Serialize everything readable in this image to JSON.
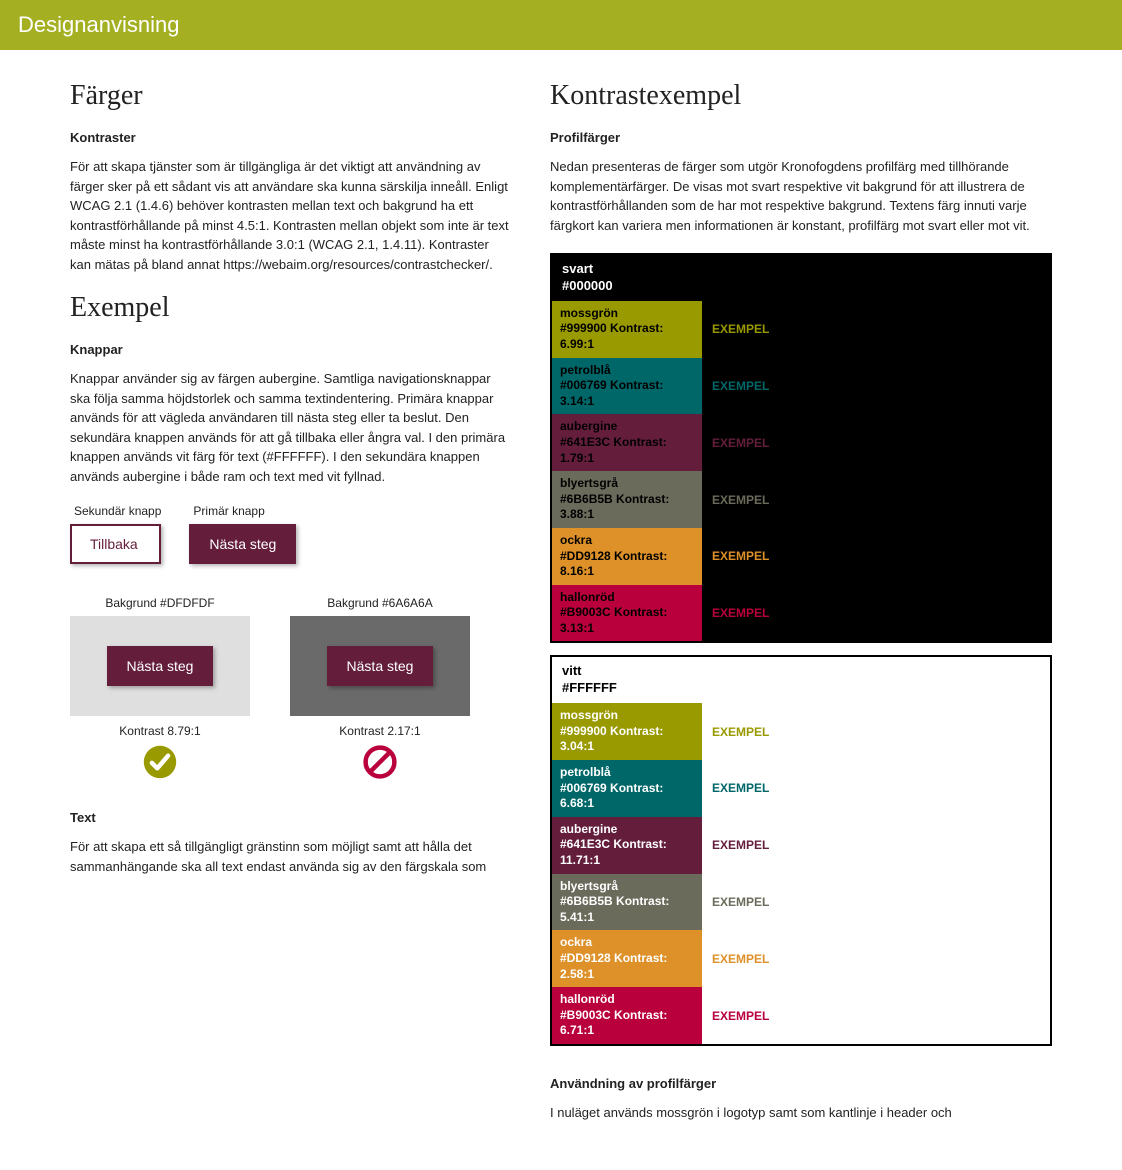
{
  "topbar": {
    "title": "Designanvisning"
  },
  "left": {
    "heading_colors": "Färger",
    "kontraster_label": "Kontraster",
    "kontraster_body": "För att skapa tjänster som är tillgängliga är det viktigt att användning av färger sker på ett sådant vis att användare ska kunna särskilja inneåll. Enligt WCAG 2.1 (1.4.6) behöver kontrasten mellan text och bakgrund ha ett kontrastförhållande på minst 4.5:1. Kontrasten mellan objekt som inte är text måste minst ha kontrastförhållande 3.0:1 (WCAG 2.1, 1.4.11). Kontraster kan mätas på bland annat https://webaim.org/resources/contrastchecker/.",
    "heading_example": "Exempel",
    "knappar_label": "Knappar",
    "knappar_body": "Knappar använder sig av färgen aubergine. Samtliga navigationsknappar ska följa samma höjdstorlek och samma textindentering. Primära knappar används för att vägleda användaren till nästa steg eller ta beslut. Den sekundära knappen används för att gå tillbaka eller ångra val. I den primära knappen används vit färg för text (#FFFFFF). I den sekundära knappen används aubergine i både ram och text med vit fyllnad.",
    "buttons": {
      "secondary_label": "Sekundär knapp",
      "secondary_text": "Tillbaka",
      "primary_label": "Primär knapp",
      "primary_text": "Nästa steg"
    },
    "bgex": {
      "light_label": "Bakgrund #DFDFDF",
      "dark_label": "Bakgrund #6A6A6A",
      "btn_text": "Nästa steg",
      "light_kontrast": "Kontrast 8.79:1",
      "dark_kontrast": "Kontrast 2.17:1"
    },
    "text_label": "Text",
    "text_body": "För att skapa ett så tillgängligt gränstinn som möjligt samt att hålla det sammanhängande ska all text endast använda sig av den färgskala som"
  },
  "right": {
    "heading": "Kontrastexempel",
    "profil_label": "Profilfärger",
    "profil_body": "Nedan presenteras de färger som utgör Kronofogdens profilfärg med tillhörande komplementärfärger. De visas mot svart respektive vit bakgrund för att illustrera de kontrastförhållanden som de har mot respektive bakgrund. Textens färg innuti varje färgkort kan variera men informationen är konstant, profilfärg mot svart eller mot vit.",
    "black_panel": {
      "name": "svart",
      "hex": "#000000",
      "rows": [
        {
          "name": "mossgrön",
          "hex": "#999900",
          "kontrast": "6.99:1",
          "bg": "#999900",
          "txt": "#000",
          "exempel_bg": "#000",
          "exempel_txt": "#999900"
        },
        {
          "name": "petrolblå",
          "hex": "#006769",
          "kontrast": "3.14:1",
          "bg": "#006769",
          "txt": "#000",
          "exempel_bg": "#000",
          "exempel_txt": "#006769"
        },
        {
          "name": "aubergine",
          "hex": "#641E3C",
          "kontrast": "1.79:1",
          "bg": "#641E3C",
          "txt": "#000",
          "exempel_bg": "#000",
          "exempel_txt": "#641E3C"
        },
        {
          "name": "blyertsgrå",
          "hex": "#6B6B5B",
          "kontrast": "3.88:1",
          "bg": "#6B6B5B",
          "txt": "#000",
          "exempel_bg": "#000",
          "exempel_txt": "#6B6B5B"
        },
        {
          "name": "ockra",
          "hex": "#DD9128",
          "kontrast": "8.16:1",
          "bg": "#DD9128",
          "txt": "#000",
          "exempel_bg": "#000",
          "exempel_txt": "#DD9128"
        },
        {
          "name": "hallonröd",
          "hex": "#B9003C",
          "kontrast": "3.13:1",
          "bg": "#B9003C",
          "txt": "#000",
          "exempel_bg": "#000",
          "exempel_txt": "#B9003C"
        }
      ]
    },
    "white_panel": {
      "name": "vitt",
      "hex": "#FFFFFF",
      "rows": [
        {
          "name": "mossgrön",
          "hex": "#999900",
          "kontrast": "3.04:1",
          "bg": "#999900",
          "txt": "#fff",
          "exempel_bg": "#fff",
          "exempel_txt": "#999900"
        },
        {
          "name": "petrolblå",
          "hex": "#006769",
          "kontrast": "6.68:1",
          "bg": "#006769",
          "txt": "#fff",
          "exempel_bg": "#fff",
          "exempel_txt": "#006769"
        },
        {
          "name": "aubergine",
          "hex": "#641E3C",
          "kontrast": "11.71:1",
          "bg": "#641E3C",
          "txt": "#fff",
          "exempel_bg": "#fff",
          "exempel_txt": "#641E3C"
        },
        {
          "name": "blyertsgrå",
          "hex": "#6B6B5B",
          "kontrast": "5.41:1",
          "bg": "#6B6B5B",
          "txt": "#fff",
          "exempel_bg": "#fff",
          "exempel_txt": "#6B6B5B"
        },
        {
          "name": "ockra",
          "hex": "#DD9128",
          "kontrast": "2.58:1",
          "bg": "#DD9128",
          "txt": "#fff",
          "exempel_bg": "#fff",
          "exempel_txt": "#DD9128"
        },
        {
          "name": "hallonröd",
          "hex": "#B9003C",
          "kontrast": "6.71:1",
          "bg": "#B9003C",
          "txt": "#fff",
          "exempel_bg": "#fff",
          "exempel_txt": "#B9003C"
        }
      ]
    },
    "exempel_label": "EXEMPEL",
    "anvandning_label": "Användning av profilfärger",
    "anvandning_body": "I nuläget används mossgrön i logotyp samt som kantlinje i header och"
  }
}
